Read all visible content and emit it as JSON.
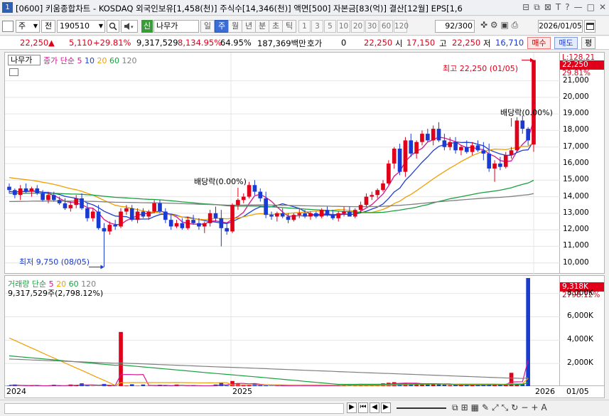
{
  "window": {
    "number": "1",
    "title": "[0600] 키움종합차트 - KOSDAQ 외국인보유[1,458(천)] 주식수[14,346(천)] 액면[500] 자본금[83(억)] 결산[12월] EPS[1,6",
    "buttons": [
      "⊟",
      "⧉",
      "⊠",
      "T",
      "?",
      "—",
      "□",
      "✕"
    ]
  },
  "toolbar": {
    "type_select": "주",
    "prev_label": "전",
    "code": "190510",
    "search_icon": "search-icon",
    "sound_icon": "speaker-icon",
    "new_badge": "신",
    "stock_name": "나무가",
    "periods": [
      "일",
      "주",
      "월",
      "년",
      "분",
      "초",
      "틱"
    ],
    "selected_period": "주",
    "numbers": [
      "1",
      "3",
      "5",
      "10",
      "20",
      "30",
      "60",
      "120"
    ],
    "count": "92",
    "count_total": "/300",
    "date": "2026/01/05"
  },
  "info": {
    "price": "22,250",
    "change_arrow": "▲",
    "change": "5,110",
    "change_pct": "+29.81%",
    "volume": "9,317,529",
    "volume_pct": "8,134.95%",
    "turnover": "64.95%",
    "amount": "187,369백만",
    "hoga_label": "호가",
    "hoga_value": "0",
    "hoga_price": "22,250",
    "open_label": "시",
    "open": "17,150",
    "high_label": "고",
    "high": "22,250",
    "low_label": "저",
    "low": "16,710",
    "buy_label": "매수",
    "sell_label": "매도",
    "eval_label": "평"
  },
  "price_panel": {
    "stock_tab": "나무가",
    "legend_label": "종가 단순",
    "ma_periods": [
      "5",
      "10",
      "20",
      "60",
      "120"
    ],
    "ma_colors": [
      "#d4168f",
      "#1f3fd1",
      "#f0a000",
      "#18a040",
      "#808080"
    ],
    "high_annotation": "최고 22,250 (01/05)",
    "low_annotation": "최저 9,750 (08/05)",
    "dividend_label_1": "배당락(0.00%)",
    "dividend_label_2": "배당락(0.00%)",
    "axis_top_label": "L:128.21",
    "current_price_tag": "22,250",
    "current_pct_tag": "29.81%",
    "axis_labels": [
      "21,000",
      "20,000",
      "19,000",
      "18,000",
      "17,000",
      "16,000",
      "15,000",
      "14,000",
      "13,000",
      "12,000",
      "11,000",
      "10,000"
    ]
  },
  "volume_panel": {
    "legend_label": "거래량",
    "legend_ma": "단순",
    "ma_periods": [
      "5",
      "20",
      "60",
      "120"
    ],
    "ma_colors": [
      "#d4168f",
      "#f0a000",
      "#18a040",
      "#808080"
    ],
    "volume_text": "9,317,529주(2,798.12%)",
    "tag_volume": "9,318K",
    "tag_pct": "2798.12%",
    "axis_labels": [
      "8,000K",
      "6,000K",
      "4,000K",
      "2,000K"
    ]
  },
  "date_axis": {
    "labels": [
      "2024",
      "2025",
      "2026"
    ],
    "current": "01/05"
  },
  "scrollbar": {
    "buttons": [
      "◀",
      "▶",
      "⏮",
      "◀",
      "▶",
      "⏭"
    ],
    "zoom_minus": "−",
    "zoom_plus": "+",
    "font_label": "A"
  },
  "chart_data": {
    "type": "candlestick",
    "period": "weekly",
    "ylim": [
      9300,
      22700
    ],
    "candles": [
      [
        14600,
        14800,
        14200,
        14400
      ],
      [
        14400,
        14500,
        13900,
        14100
      ],
      [
        14100,
        14700,
        13800,
        14500
      ],
      [
        14500,
        14800,
        14200,
        14300
      ],
      [
        14300,
        14600,
        14000,
        14500
      ],
      [
        14500,
        14700,
        14100,
        14200
      ],
      [
        14200,
        14400,
        13700,
        13800
      ],
      [
        13800,
        14300,
        13600,
        14100
      ],
      [
        14100,
        14300,
        13700,
        13800
      ],
      [
        13800,
        14000,
        13500,
        13600
      ],
      [
        13600,
        13900,
        13200,
        13300
      ],
      [
        13300,
        13700,
        13100,
        13500
      ],
      [
        13500,
        14100,
        13300,
        13900
      ],
      [
        13900,
        14200,
        13200,
        13300
      ],
      [
        13300,
        13600,
        12500,
        12700
      ],
      [
        12700,
        13300,
        12500,
        13100
      ],
      [
        13100,
        13500,
        12000,
        12100
      ],
      [
        12100,
        12400,
        9750,
        11900
      ],
      [
        11900,
        12500,
        11700,
        12300
      ],
      [
        12300,
        12600,
        12000,
        12200
      ],
      [
        12200,
        13300,
        12100,
        13100
      ],
      [
        13100,
        13500,
        12900,
        13300
      ],
      [
        13300,
        13500,
        12500,
        12600
      ],
      [
        12600,
        13300,
        12400,
        13100
      ],
      [
        13100,
        13300,
        12700,
        12800
      ],
      [
        12800,
        13200,
        12600,
        13100
      ],
      [
        13100,
        13800,
        13000,
        13600
      ],
      [
        13600,
        13800,
        13000,
        13100
      ],
      [
        13100,
        13300,
        12400,
        12600
      ],
      [
        12600,
        12900,
        12000,
        12200
      ],
      [
        12200,
        12600,
        12100,
        12400
      ],
      [
        12400,
        12700,
        12000,
        12100
      ],
      [
        12100,
        12800,
        12000,
        12600
      ],
      [
        12600,
        12900,
        12300,
        12400
      ],
      [
        12400,
        12700,
        12000,
        12200
      ],
      [
        12200,
        12500,
        11800,
        12400
      ],
      [
        12400,
        13200,
        12200,
        13000
      ],
      [
        13000,
        13400,
        12500,
        12700
      ],
      [
        12700,
        13200,
        11000,
        12100
      ],
      [
        12100,
        12400,
        11700,
        11900
      ],
      [
        11900,
        13600,
        11800,
        13500
      ],
      [
        13500,
        13900,
        13200,
        13800
      ],
      [
        13800,
        14200,
        13600,
        14000
      ],
      [
        14000,
        14900,
        13900,
        14700
      ],
      [
        14700,
        15000,
        14100,
        14300
      ],
      [
        14300,
        14500,
        13700,
        13900
      ],
      [
        13900,
        14300,
        12700,
        12900
      ],
      [
        12900,
        13100,
        12600,
        12800
      ],
      [
        12800,
        13100,
        12500,
        13000
      ],
      [
        13000,
        13300,
        12700,
        12800
      ],
      [
        12800,
        13000,
        12400,
        12600
      ],
      [
        12600,
        13000,
        12500,
        12900
      ],
      [
        12900,
        13300,
        12700,
        13000
      ],
      [
        13000,
        13200,
        12700,
        12800
      ],
      [
        12800,
        13100,
        12600,
        13000
      ],
      [
        13000,
        13100,
        12700,
        12800
      ],
      [
        12800,
        13300,
        12700,
        13200
      ],
      [
        13200,
        13400,
        12800,
        12900
      ],
      [
        12900,
        13200,
        12600,
        12700
      ],
      [
        12700,
        13100,
        12500,
        13000
      ],
      [
        13000,
        13400,
        12800,
        13100
      ],
      [
        13100,
        13400,
        12800,
        12800
      ],
      [
        12800,
        13300,
        12700,
        13200
      ],
      [
        13200,
        13700,
        13000,
        13500
      ],
      [
        13500,
        14200,
        13400,
        14000
      ],
      [
        14000,
        14300,
        13800,
        14100
      ],
      [
        14100,
        14500,
        13900,
        14400
      ],
      [
        14400,
        15000,
        14300,
        14800
      ],
      [
        14800,
        16200,
        14700,
        16000
      ],
      [
        16000,
        17000,
        15700,
        16900
      ],
      [
        16900,
        17200,
        15300,
        15500
      ],
      [
        15500,
        17600,
        15200,
        17400
      ],
      [
        17400,
        17800,
        16400,
        16600
      ],
      [
        16600,
        17400,
        16300,
        17300
      ],
      [
        17300,
        18000,
        17100,
        17800
      ],
      [
        17800,
        18100,
        17300,
        17400
      ],
      [
        17400,
        18300,
        17100,
        18100
      ],
      [
        18100,
        18500,
        17300,
        17400
      ],
      [
        17400,
        17800,
        16800,
        17000
      ],
      [
        17000,
        17600,
        16800,
        17300
      ],
      [
        17300,
        17600,
        16600,
        16800
      ],
      [
        16800,
        17100,
        16500,
        17000
      ],
      [
        17000,
        17400,
        16600,
        16700
      ],
      [
        16700,
        17300,
        16500,
        17100
      ],
      [
        17100,
        17400,
        16700,
        16800
      ],
      [
        16800,
        17300,
        16200,
        16600
      ],
      [
        16600,
        17200,
        15500,
        15700
      ],
      [
        15700,
        16200,
        14900,
        16000
      ],
      [
        16000,
        16400,
        15600,
        15800
      ],
      [
        15800,
        16700,
        15700,
        16500
      ],
      [
        16500,
        17000,
        16300,
        16800
      ],
      [
        16800,
        18800,
        16700,
        18600
      ],
      [
        18600,
        18900,
        17800,
        18100
      ],
      [
        18100,
        18200,
        17100,
        17400
      ],
      [
        17150,
        22250,
        16710,
        22250
      ]
    ],
    "volume_ylim": [
      0,
      9500000
    ],
    "volumes": [
      100000,
      200000,
      50000,
      80000,
      150000,
      120000,
      60000,
      90000,
      180000,
      110000,
      70000,
      200000,
      150000,
      300000,
      120000,
      80000,
      60000,
      250000,
      150000,
      90000,
      4700000,
      100000,
      220000,
      80000,
      200000,
      70000,
      50000,
      180000,
      130000,
      90000,
      200000,
      60000,
      80000,
      150000,
      40000,
      90000,
      110000,
      200000,
      350000,
      120000,
      500000,
      300000,
      200000,
      150000,
      250000,
      180000,
      120000,
      80000,
      90000,
      100000,
      60000,
      80000,
      70000,
      90000,
      100000,
      80000,
      60000,
      110000,
      150000,
      120000,
      180000,
      200000,
      130000,
      250000,
      200000,
      150000,
      180000,
      300000,
      350000,
      400000,
      250000,
      300000,
      280000,
      320000,
      200000,
      250000,
      300000,
      220000,
      180000,
      150000,
      200000,
      250000,
      180000,
      220000,
      150000,
      180000,
      200000,
      250000,
      200000,
      230000,
      1200000,
      250000,
      300000,
      9317529
    ],
    "high_label_value": 22250,
    "low_label_value": 9750
  }
}
